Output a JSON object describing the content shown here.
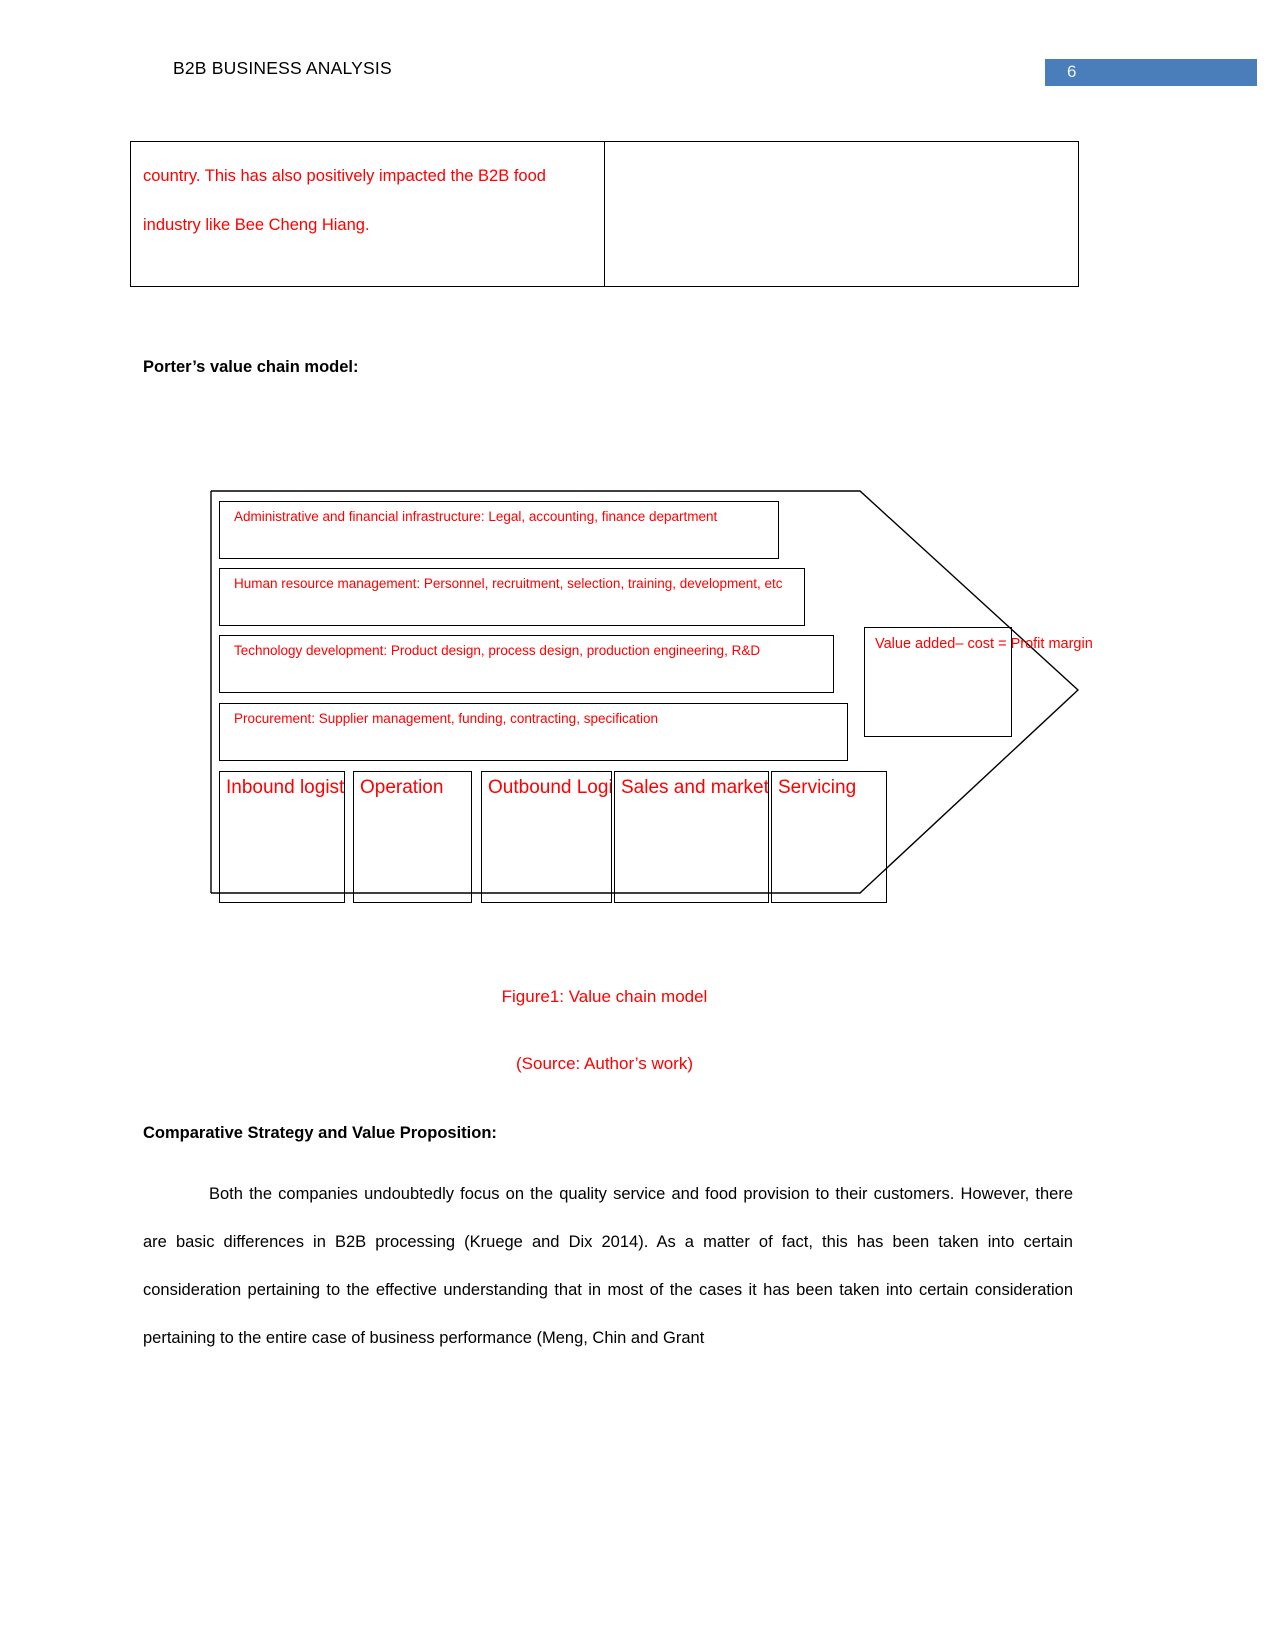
{
  "header": {
    "title": "B2B BUSINESS ANALYSIS",
    "page_number": "6",
    "badge_color": "#4a7ebb"
  },
  "top_table": {
    "left_cell": {
      "line1": "country. This has also positively impacted the B2B food",
      "line2": "industry like Bee Cheng Hiang."
    },
    "right_cell": {
      "text": ""
    }
  },
  "headings": {
    "porter": "Porter’s value chain model:",
    "comparative": "Comparative Strategy and Value Proposition:"
  },
  "diagram": {
    "support_activities": [
      {
        "label": "Administrative and financial infrastructure: Legal, accounting, finance department"
      },
      {
        "label": "Human resource management: Personnel, recruitment, selection, training, development, etc"
      },
      {
        "label": "Technology development: Product design, process design, production engineering, R&D"
      },
      {
        "label": "Procurement: Supplier management, funding, contracting, specification"
      }
    ],
    "primary_activities": [
      {
        "label": "Inbound logistics"
      },
      {
        "label": "Operation"
      },
      {
        "label": "Outbound Logistics"
      },
      {
        "label": "Sales and marketing"
      },
      {
        "label": "Servicing"
      }
    ],
    "margin_box": {
      "label": "Value added– cost = Profit margin"
    },
    "text_color": "#ff0000",
    "line_color": "#000000"
  },
  "captions": {
    "figure": "Figure1: Value chain model",
    "source": "(Source: Author’s work)"
  },
  "body": {
    "paragraph": "Both the companies undoubtedly focus on the quality service and food provision to their customers. However, there are basic differences in B2B processing (Kruege and Dix 2014).  As a matter of fact, this has been taken into certain consideration pertaining to the effective understanding that in most of the cases it has been taken into certain consideration pertaining to the entire case of business performance (Meng, Chin and Grant"
  }
}
